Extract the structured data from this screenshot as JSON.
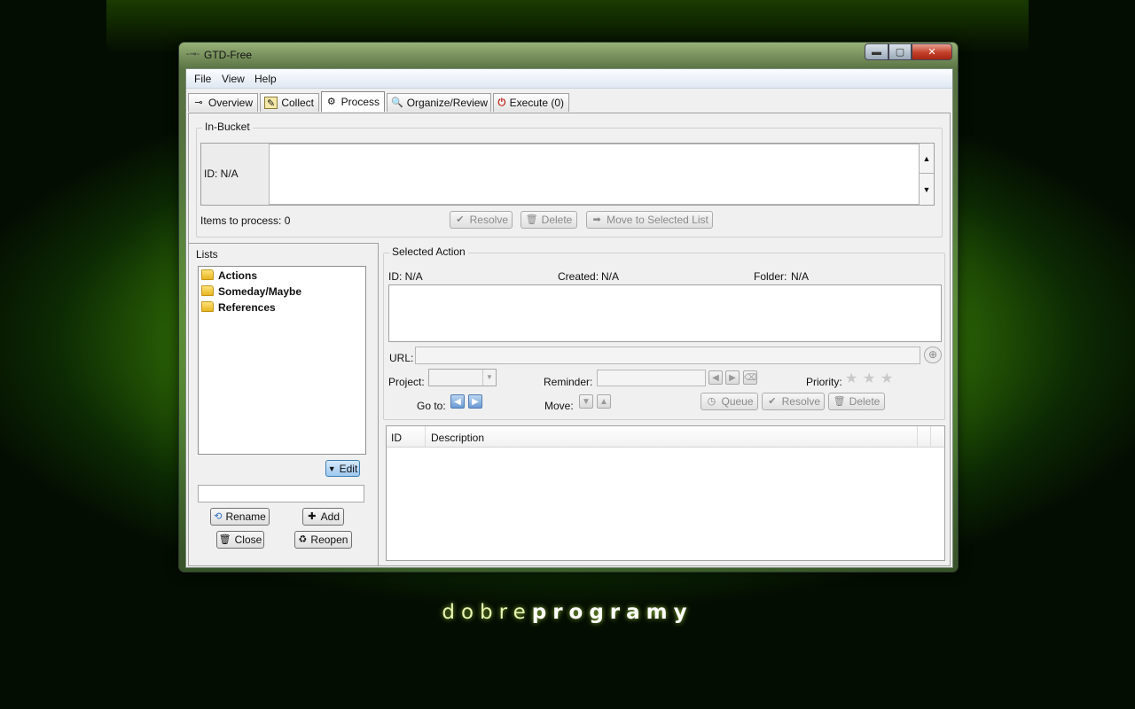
{
  "window": {
    "title": "GTD-Free",
    "min_label": "▬",
    "max_label": "▢",
    "close_label": "✕"
  },
  "menu": [
    "File",
    "View",
    "Help"
  ],
  "tabs": [
    {
      "label": "Overview",
      "icon": "overview-icon",
      "glyph": "⊸"
    },
    {
      "label": "Collect",
      "icon": "collect-icon",
      "glyph": "✎"
    },
    {
      "label": "Process",
      "icon": "process-icon",
      "glyph": "⚙"
    },
    {
      "label": "Organize/Review",
      "icon": "magnifier-icon",
      "glyph": "🔍"
    },
    {
      "label": "Execute (0)",
      "icon": "execute-icon",
      "glyph": "⏻"
    }
  ],
  "active_tab": "Process",
  "in_bucket": {
    "title": "In-Bucket",
    "id_label": "ID: N/A",
    "items_to_process": "Items to process: 0",
    "buttons": {
      "resolve": "Resolve",
      "delete": "Delete",
      "move": "Move to Selected List"
    }
  },
  "lists": {
    "title": "Lists",
    "items": [
      "Actions",
      "Someday/Maybe",
      "References"
    ],
    "edit_label": "Edit",
    "name_input_value": "",
    "buttons": {
      "rename": "Rename",
      "add": "Add",
      "close": "Close",
      "reopen": "Reopen"
    }
  },
  "selected_action": {
    "title": "Selected Action",
    "id_label": "ID: N/A",
    "created_label": "Created:",
    "created_value": "N/A",
    "folder_label": "Folder:",
    "folder_value": "N/A",
    "url_label": "URL:",
    "project_label": "Project:",
    "reminder_label": "Reminder:",
    "priority_label": "Priority:",
    "goto_label": "Go to:",
    "move_label": "Move:",
    "buttons": {
      "queue": "Queue",
      "resolve": "Resolve",
      "delete": "Delete"
    }
  },
  "table": {
    "columns": [
      "ID",
      "Description"
    ]
  },
  "watermark": {
    "light": "dobre",
    "bold": "programy"
  }
}
